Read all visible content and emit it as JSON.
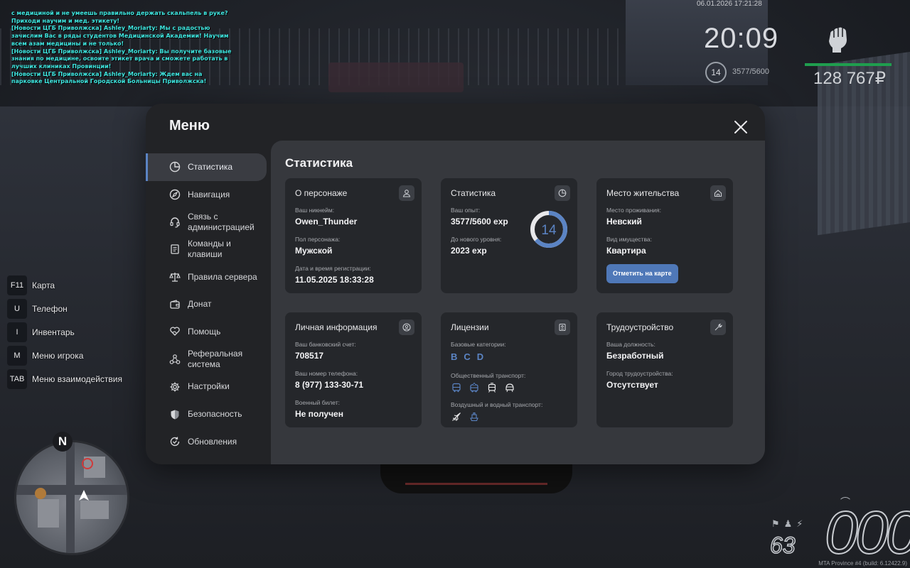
{
  "chat": [
    " с медициной и не умеешь правильно держать скальпель в руке? Приходи научим и мед. этикету!",
    "[Новости ЦГБ Приволжска] Ashley_Moriarty: Мы с радостью зачислим Вас в ряды студентов Медицинской Академии! Научим всем азам медицины и не только!",
    "[Новости ЦГБ Приволжска] Ashley_Moriarty: Вы получите базовые знания по медицине, освоите этикет врача и сможете работать в лучших клиниках Провинции!",
    "[Новости ЦГБ Приволжска] Ashley_Moriarty: Ждем вас на парковке Центральной Городской Больницы Приволжска!"
  ],
  "hud": {
    "datetime": "06.01.2026 17:21:28",
    "time": "20:09",
    "level": "14",
    "exp": "3577/5600",
    "money": "128 767₽"
  },
  "keybinds": [
    {
      "key": "F11",
      "label": "Карта"
    },
    {
      "key": "U",
      "label": "Телефон"
    },
    {
      "key": "I",
      "label": "Инвентарь"
    },
    {
      "key": "M",
      "label": "Меню игрока"
    },
    {
      "key": "TAB",
      "label": "Меню взаимодействия"
    }
  ],
  "minimap": {
    "north": "N"
  },
  "speedometer": {
    "speed": "000",
    "fuel": "63"
  },
  "build": "MTA Province #4 (build: 6.12422.9)",
  "menu": {
    "title": "Меню",
    "close_icon": "close-icon",
    "nav": [
      {
        "label": "Статистика",
        "icon": "pie-chart-icon",
        "active": true
      },
      {
        "label": "Навигация",
        "icon": "compass-icon"
      },
      {
        "label": "Связь с администрацией",
        "icon": "headset-icon"
      },
      {
        "label": "Команды и клавиши",
        "icon": "document-icon"
      },
      {
        "label": "Правила сервера",
        "icon": "scales-icon"
      },
      {
        "label": "Донат",
        "icon": "wallet-icon"
      },
      {
        "label": "Помощь",
        "icon": "heart-hand-icon"
      },
      {
        "label": "Реферальная система",
        "icon": "network-icon"
      },
      {
        "label": "Настройки",
        "icon": "gear-icon"
      },
      {
        "label": "Безопасность",
        "icon": "shield-icon"
      },
      {
        "label": "Обновления",
        "icon": "refresh-icon"
      }
    ],
    "content_title": "Статистика",
    "cards": {
      "character": {
        "title": "О персонаже",
        "nickname_label": "Ваш никнейм:",
        "nickname": "Owen_Thunder",
        "gender_label": "Пол персонажа:",
        "gender": "Мужской",
        "reg_label": "Дата и время регистрации:",
        "reg": "11.05.2025 18:33:28"
      },
      "stats": {
        "title": "Статистика",
        "exp_label": "Ваш опыт:",
        "exp": "3577/5600 exp",
        "next_label": "До нового уровня:",
        "next": "2023 exp",
        "level": "14",
        "progress": 0.639
      },
      "residence": {
        "title": "Место жительства",
        "place_label": "Место проживания:",
        "place": "Невский",
        "property_label": "Вид имущества:",
        "property": "Квартира",
        "button": "Отметить на карте"
      },
      "personal": {
        "title": "Личная информация",
        "bank_label": "Ваш банковский счет:",
        "bank": "708517",
        "phone_label": "Ваш номер телефона:",
        "phone": "8 (977) 133-30-71",
        "military_label": "Военный билет:",
        "military": "Не получен"
      },
      "licenses": {
        "title": "Лицензии",
        "base_label": "Базовые категории:",
        "base": [
          "B",
          "C",
          "D"
        ],
        "public_label": "Общественный транспорт:",
        "public_icons": [
          "bus-icon",
          "trolleybus-icon",
          "tram-icon",
          "metro-icon"
        ],
        "air_label": "Воздушный и водный транспорт:",
        "air_icons": [
          "plane-icon",
          "boat-icon"
        ]
      },
      "job": {
        "title": "Трудоустройство",
        "position_label": "Ваша должность:",
        "position": "Безработный",
        "city_label": "Город трудоустройства:",
        "city": "Отсутствует"
      }
    }
  },
  "colors": {
    "accent": "#5b84c4",
    "panel": "#222326",
    "content": "#36383d",
    "card": "#25272b",
    "money_bar": "#1f9e4e"
  }
}
